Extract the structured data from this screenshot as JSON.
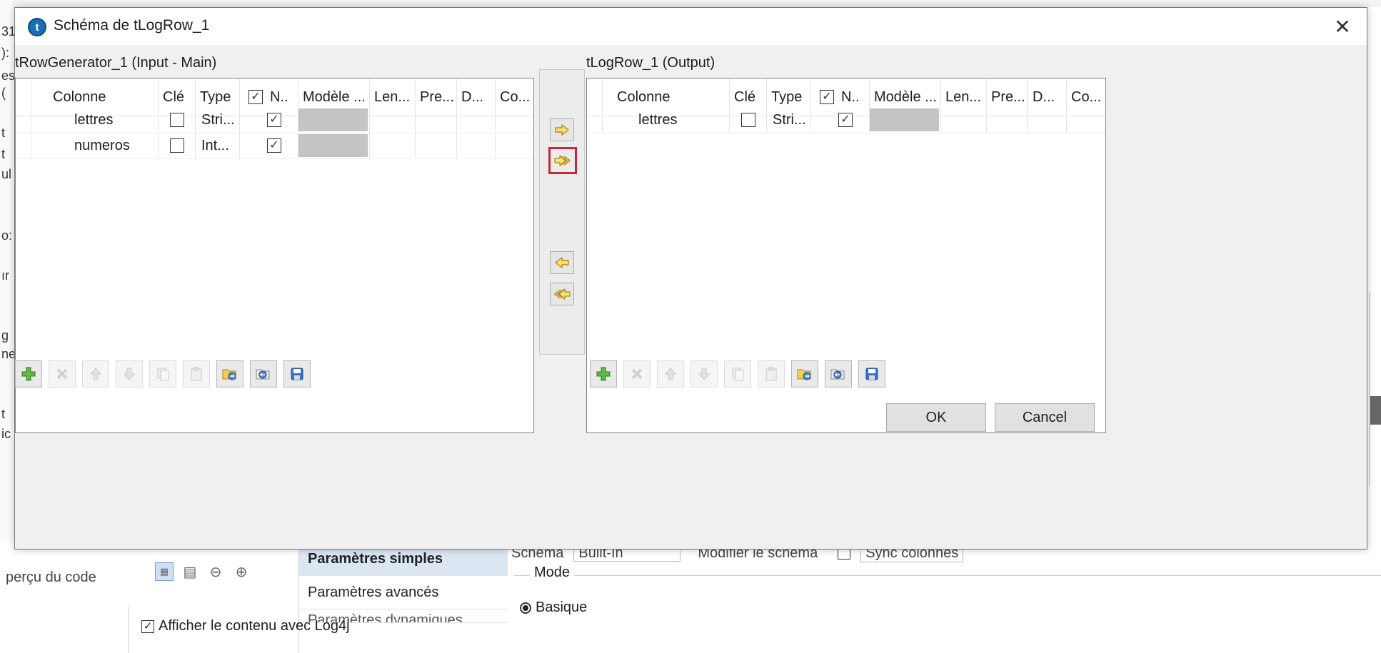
{
  "background": {
    "left_fragments": [
      "31",
      "):",
      "es",
      "(",
      "t",
      "t",
      "ul",
      "o:",
      "ır",
      "g",
      "ne",
      "t",
      "ic"
    ],
    "apercu_label": "perçu du code",
    "tabs": [
      {
        "label": "Paramètres simples",
        "active": true
      },
      {
        "label": "Paramètres avancés",
        "active": false
      },
      {
        "label": "Paramètres dynamiques",
        "active": false
      }
    ],
    "schema_row": {
      "schema_label": "Schéma",
      "schema_value": "Built-In",
      "edit_label": "Modifier le schéma",
      "sync_label": "Sync colonnes"
    },
    "mode_label": "Mode",
    "radio_basic": "Basique",
    "log4j_label": "Afficher le contenu avec Log4j"
  },
  "dialog": {
    "title": "Schéma de tLogRow_1",
    "close_icon": "close-icon",
    "left_panel": {
      "label": "tRowGenerator_1 (Input - Main)",
      "headers": [
        "Colonne",
        "Clé",
        "Type",
        "N..",
        "Modèle ...",
        "Len...",
        "Pre...",
        "D...",
        "Co..."
      ],
      "rows": [
        {
          "colonne": "lettres",
          "cle": false,
          "type": "Stri...",
          "nullable": true
        },
        {
          "colonne": "numeros",
          "cle": false,
          "type": "Int...",
          "nullable": true
        }
      ]
    },
    "right_panel": {
      "label": "tLogRow_1 (Output)",
      "headers": [
        "Colonne",
        "Clé",
        "Type",
        "N..",
        "Modèle ...",
        "Len...",
        "Pre...",
        "D...",
        "Co..."
      ],
      "rows": [
        {
          "colonne": "lettres",
          "cle": false,
          "type": "Stri...",
          "nullable": true
        }
      ]
    },
    "transfer_buttons": [
      {
        "name": "copy-selected-right",
        "icon": "arrow-right-icon"
      },
      {
        "name": "copy-all-right",
        "icon": "double-arrow-right-icon",
        "highlighted": true
      },
      {
        "name": "copy-selected-left",
        "icon": "arrow-left-icon"
      },
      {
        "name": "copy-all-left",
        "icon": "double-arrow-left-icon"
      }
    ],
    "toolbar_icons": [
      "add-icon",
      "delete-icon",
      "move-up-icon",
      "move-down-icon",
      "copy-icon",
      "paste-icon",
      "import-icon",
      "export-icon",
      "save-icon"
    ],
    "ok_label": "OK",
    "cancel_label": "Cancel",
    "colors": {
      "highlight_border": "#c6283a",
      "arrow_fill": "#f6e27a",
      "arrow_stroke": "#b58a18",
      "cell_gray": "#c4c4c4"
    }
  }
}
